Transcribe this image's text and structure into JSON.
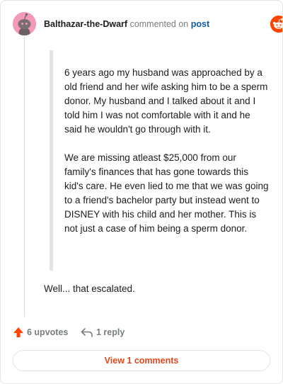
{
  "header": {
    "username": "Balthazar-the-Dwarf",
    "commented_text": "commented on",
    "post_link": "post",
    "logo_text": "reddit",
    "avatar_icon": "snoo-avatar-icon",
    "logo_icon": "reddit-logo-icon",
    "accent_color": "#ff4500"
  },
  "comment": {
    "quote_paragraphs": [
      "6 years ago my husband was approached by a old friend and her wife asking him to be a sperm donor. My husband and I talked about it and I told him I was not comfortable with it and he said he wouldn't go through with it.",
      "We are missing atleast $25,000 from our family's finances that has gone towards this kid's care. He even lied to me that we was going to a friend's bachelor party but instead went to DISNEY with his child and her mother. This is not just a case of him being a sperm donor."
    ],
    "body": "Well... that escalated."
  },
  "actions": {
    "upvotes_label": "6 upvotes",
    "reply_label": "1 reply",
    "upvote_icon": "upvote-arrow-icon",
    "reply_icon": "reply-arrow-icon"
  },
  "footer": {
    "view_comments_label": "View 1 comments"
  }
}
